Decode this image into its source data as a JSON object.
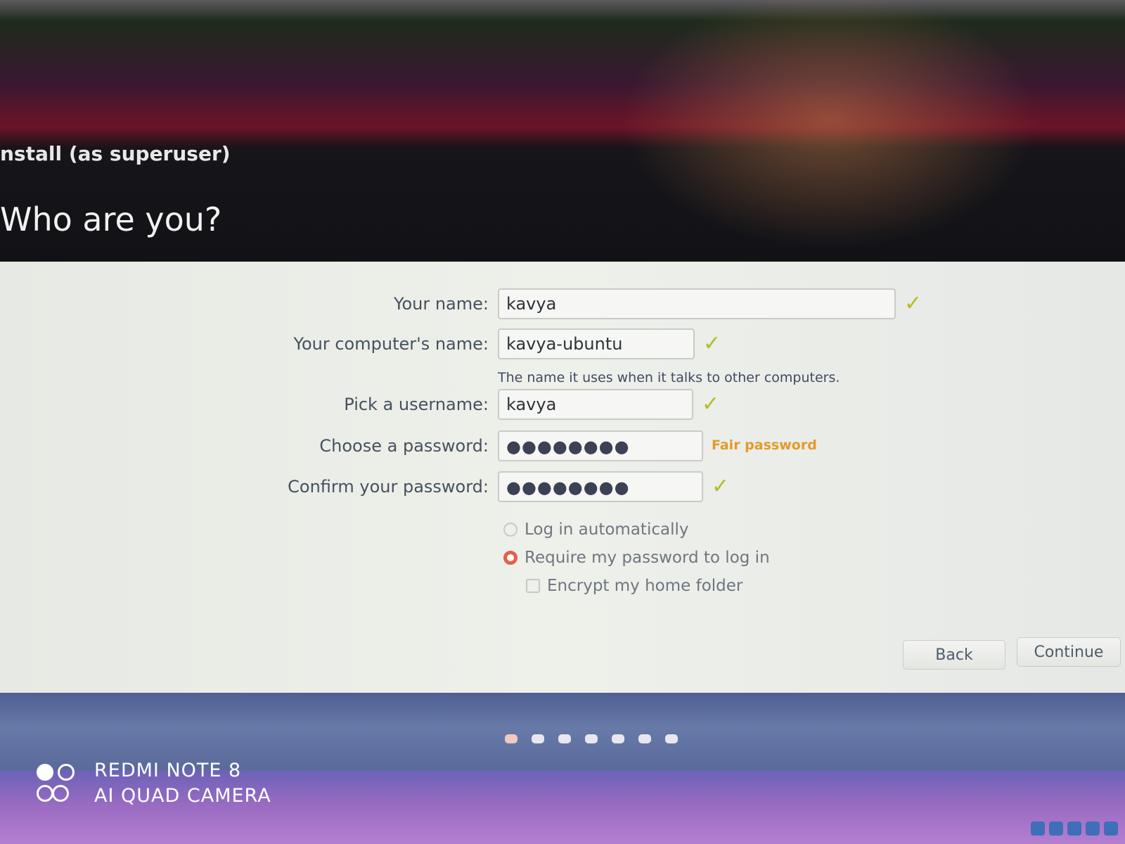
{
  "window": {
    "title": "nstall (as superuser)"
  },
  "page": {
    "heading": "Who are you?"
  },
  "form": {
    "your_name": {
      "label": "Your name:",
      "value": "kavya"
    },
    "computer_name": {
      "label": "Your computer's name:",
      "value": "kavya-ubuntu",
      "hint": "The name it uses when it talks to other computers."
    },
    "username": {
      "label": "Pick a username:",
      "value": "kavya"
    },
    "password": {
      "label": "Choose a password:",
      "value": "●●●●●●●●",
      "strength": "Fair password"
    },
    "confirm_password": {
      "label": "Confirm your password:",
      "value": "●●●●●●●●"
    },
    "login_options": {
      "auto_login": "Log in automatically",
      "require_password": "Require my password to log in",
      "selected": "require_password",
      "encrypt_home": "Encrypt my home folder",
      "encrypt_checked": false
    }
  },
  "buttons": {
    "back": "Back",
    "continue": "Continue"
  },
  "progress": {
    "total_steps": 7,
    "current_step": 1
  },
  "watermark": {
    "line1": "REDMI NOTE 8",
    "line2": "AI QUAD CAMERA"
  },
  "icons": {
    "valid": "check-icon",
    "valid_color": "#b3bd22",
    "strength_color": "#e39a2a",
    "radio_selected_color": "#e0624c"
  }
}
